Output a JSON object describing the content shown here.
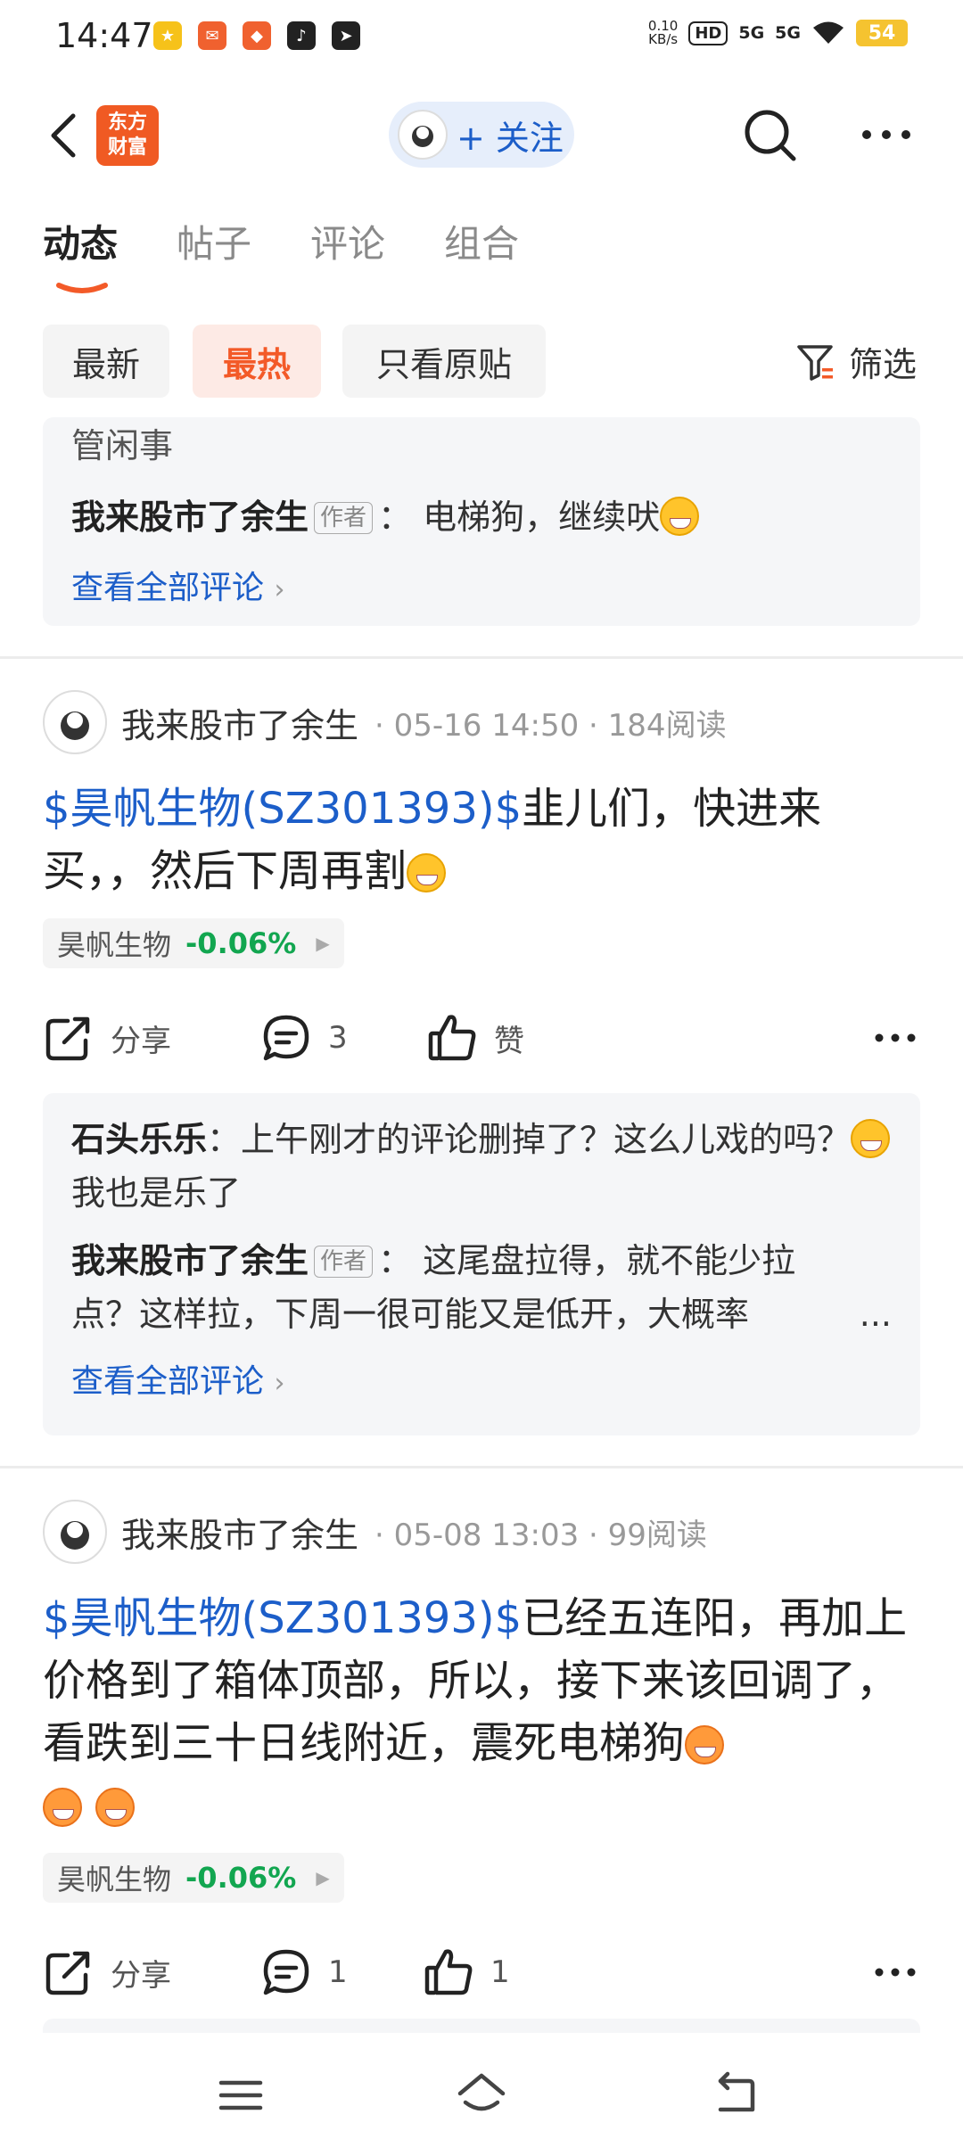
{
  "status_bar": {
    "time": "14:47",
    "net_speed_value": "0.10",
    "net_speed_unit": "KB/s",
    "hd_label": "HD",
    "sig1": "5G",
    "sig2": "5G",
    "battery": "54"
  },
  "header": {
    "logo_line1": "东方",
    "logo_line2": "财富",
    "follow_label": "+ 关注"
  },
  "tabs": [
    {
      "label": "动态",
      "active": true
    },
    {
      "label": "帖子",
      "active": false
    },
    {
      "label": "评论",
      "active": false
    },
    {
      "label": "组合",
      "active": false
    }
  ],
  "filters": {
    "chips": [
      "最新",
      "最热",
      "只看原贴"
    ],
    "active_index": 1,
    "filter_label": "筛选"
  },
  "top_comment_card": {
    "partial_text": "管闲事",
    "comment_author": "我来股市了余生",
    "author_tag": "作者",
    "comment_text": "：  电梯狗，继续吠",
    "view_all": "查看全部评论"
  },
  "posts": [
    {
      "author": "我来股市了余生",
      "date": "05-16 14:50",
      "reads": "184阅读",
      "stock_tag": "$昊帆生物(SZ301393)$",
      "text": "韭儿们，快进来买，，然后下周再割",
      "quote_name": "昊帆生物",
      "quote_pct": "-0.06%",
      "share_label": "分享",
      "comment_count": "3",
      "like_label": "赞",
      "comments": {
        "c1_author": "石头乐乐",
        "c1_text": "：上午刚才的评论删掉了？这么儿戏的吗？",
        "c1_tail": "我也是乐了",
        "c2_author": "我来股市了余生",
        "c2_tag": "作者",
        "c2_text": "：  这尾盘拉得，就不能少拉点？这样拉，下周一很可能又是低开，大概率",
        "ellipsis": "...",
        "view_all": "查看全部评论"
      }
    },
    {
      "author": "我来股市了余生",
      "date": "05-08 13:03",
      "reads": "99阅读",
      "stock_tag": "$昊帆生物(SZ301393)$",
      "text": "已经五连阳，再加上价格到了箱体顶部，所以，接下来该回调了，看跌到三十日线附近，震死电梯狗",
      "quote_name": "昊帆生物",
      "quote_pct": "-0.06%",
      "share_label": "分享",
      "comment_count": "1",
      "like_count": "1"
    }
  ],
  "colors": {
    "accent_blue": "#1c5ec9",
    "brand_orange": "#f35a28",
    "down_green": "#12a650"
  }
}
